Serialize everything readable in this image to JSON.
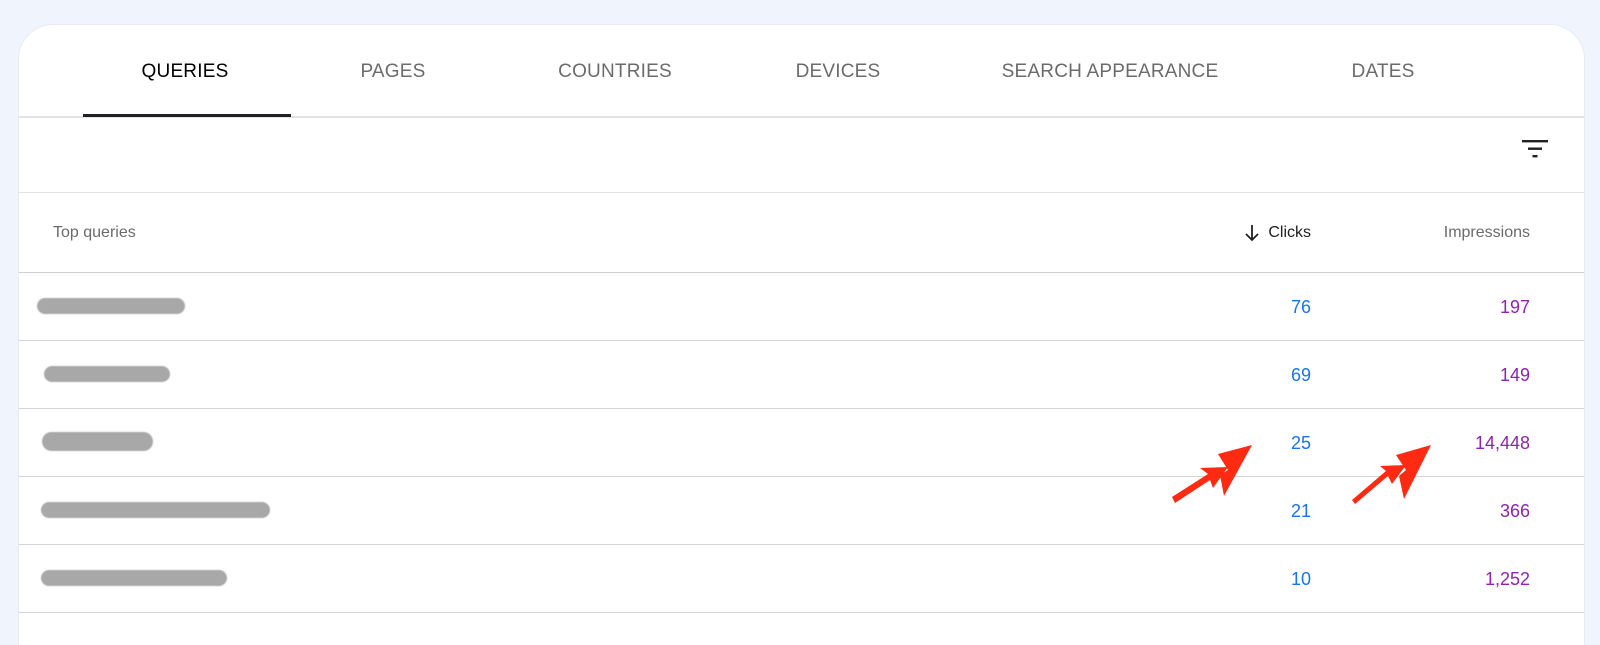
{
  "tabs": [
    {
      "label": "QUERIES",
      "active": true
    },
    {
      "label": "PAGES"
    },
    {
      "label": "COUNTRIES"
    },
    {
      "label": "DEVICES"
    },
    {
      "label": "SEARCH APPEARANCE"
    },
    {
      "label": "DATES"
    }
  ],
  "toolbar": {
    "filter_icon": "filter-list-icon"
  },
  "table": {
    "columns": {
      "query": "Top queries",
      "clicks": "Clicks",
      "impressions": "Impressions",
      "sort_icon": "arrow-down-icon"
    },
    "rows": [
      {
        "query": "",
        "clicks": "76",
        "impressions": "197"
      },
      {
        "query": "",
        "clicks": "69",
        "impressions": "149"
      },
      {
        "query": "",
        "clicks": "25",
        "impressions": "14,448"
      },
      {
        "query": "",
        "clicks": "21",
        "impressions": "366"
      },
      {
        "query": "",
        "clicks": "10",
        "impressions": "1,252"
      }
    ]
  },
  "colors": {
    "clicks": "#1a73e8",
    "impressions": "#8e24aa",
    "annotation_arrow": "#ff2a12"
  },
  "annotations": [
    "red-arrow-clicks",
    "red-arrow-impressions"
  ]
}
